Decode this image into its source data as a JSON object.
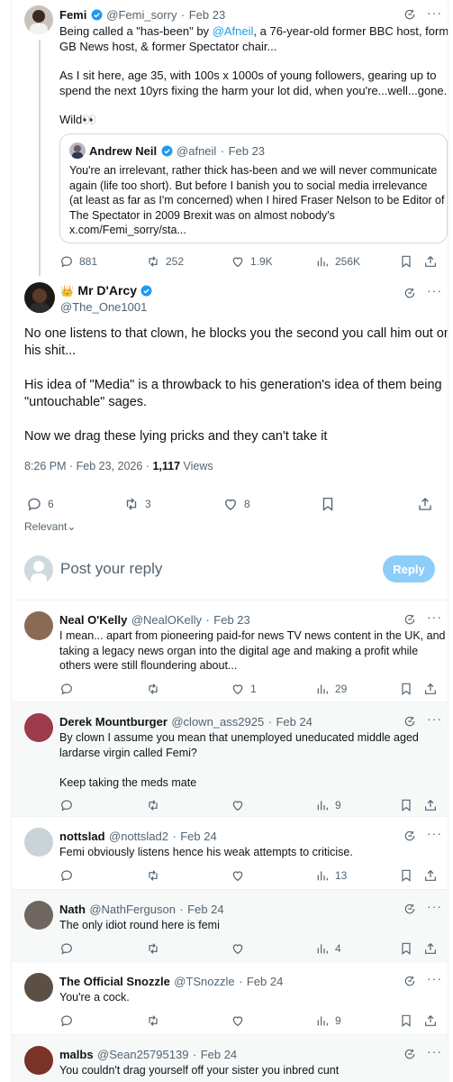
{
  "top_tweet": {
    "author": "Femi",
    "handle": "@Femi_sorry",
    "time": "Feb 23",
    "line1_pre": "Being called a \"has-been\" by ",
    "line1_mention": "@Afneil",
    "line1_post": ", a 76-year-old former BBC host, former",
    "line2": "GB News host, & former Spectator chair...",
    "para2_line1": "As I sit here, age 35, with 100s x 1000s of young followers, gearing up to",
    "para2_line2": "spend the next 10yrs fixing the harm your lot did, when you're...well...gone.",
    "para3": "Wild👀",
    "quote": {
      "author": "Andrew Neil",
      "handle": "@afneil",
      "time": "Feb 23",
      "lines": [
        "You're an irrelevant, rather thick has-been and we will never communicate",
        "again (life too short). But before I banish you to social media irrelevance",
        "(at least as far as I'm concerned) when I hired Fraser Nelson to be Editor of",
        "The Spectator in 2009 Brexit was on almost nobody's",
        "x.com/Femi_sorry/sta..."
      ]
    },
    "replies": "881",
    "reposts": "252",
    "likes": "1.9K",
    "views": "256K"
  },
  "main_tweet": {
    "author_emoji": "👑",
    "author": "Mr D'Arcy",
    "handle": "@The_One1001",
    "p1_line1": "No one listens to that clown, he blocks you the second you call him out on",
    "p1_line2": "his shit...",
    "p2_line1": "His idea of \"Media\" is a throwback to his generation's idea of them being",
    "p2_line2": "\"untouchable\" sages.",
    "p3": "Now we drag these lying pricks and they can't take it",
    "timestamp": "8:26 PM · Feb 23, 2026 · ",
    "views_count": "1,117",
    "views_label": " Views",
    "replies": "6",
    "reposts": "3",
    "likes": "8",
    "relevant": "Relevant"
  },
  "composer": {
    "placeholder": "Post your reply",
    "button": "Reply"
  },
  "replies": [
    {
      "author": "Neal O'Kelly",
      "handle": "@NealOKelly",
      "time": "Feb 23",
      "lines": [
        "I mean... apart from pioneering paid-for news TV news content in the UK, and",
        "taking a legacy news organ into the digital age and making a profit while",
        "others were still floundering about..."
      ],
      "replies": "",
      "reposts": "",
      "likes": "1",
      "views": "29"
    },
    {
      "author": "Derek Mountburger",
      "handle": "@clown_ass2925",
      "time": "Feb 24",
      "lines": [
        "By clown I assume you mean that unemployed uneducated middle aged",
        "lardarse virgin called Femi?",
        "",
        "Keep taking the meds mate"
      ],
      "replies": "",
      "reposts": "",
      "likes": "",
      "views": "9"
    },
    {
      "author": "nottslad",
      "handle": "@nottslad2",
      "time": "Feb 24",
      "lines": [
        "Femi obviously listens hence his weak attempts to criticise."
      ],
      "replies": "",
      "reposts": "",
      "likes": "",
      "views": "13"
    },
    {
      "author": "Nath",
      "handle": "@NathFerguson",
      "time": "Feb 24",
      "lines": [
        "The only idiot round here is femi"
      ],
      "replies": "",
      "reposts": "",
      "likes": "",
      "views": "4"
    },
    {
      "author": "The Official Snozzle",
      "handle": "@TSnozzle",
      "time": "Feb 24",
      "lines": [
        "You're a cock."
      ],
      "replies": "",
      "reposts": "",
      "likes": "",
      "views": "9"
    },
    {
      "author": "malbs",
      "handle": "@Sean25795139",
      "time": "Feb 24",
      "lines": [
        "You couldn't drag yourself off your sister you inbred cunt"
      ],
      "replies": "",
      "reposts": "",
      "likes": "",
      "views": ""
    }
  ],
  "colors": {
    "accent": "#1d9bf0",
    "reply_button": "#8ecdf8",
    "muted": "#536471"
  },
  "icons": [
    "grok-icon",
    "more-icon",
    "reply-icon",
    "repost-icon",
    "like-icon",
    "views-icon",
    "bookmark-icon",
    "share-icon",
    "verified-icon",
    "chevron-down-icon",
    "default-avatar-icon"
  ]
}
